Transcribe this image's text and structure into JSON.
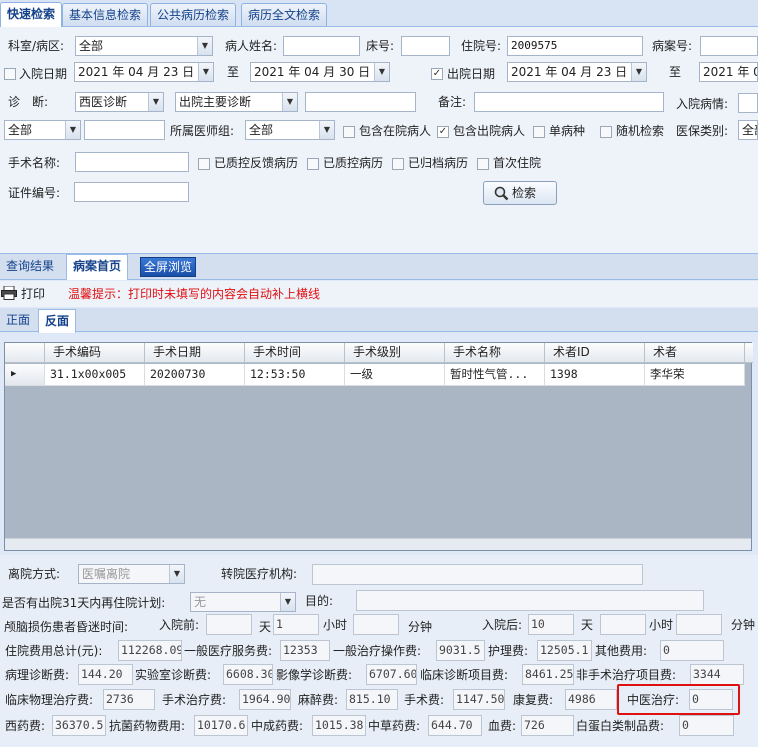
{
  "top_tabs": [
    "快速检索",
    "基本信息检索",
    "公共病历检索",
    "病历全文检索"
  ],
  "search": {
    "dept_label": "科室/病区:",
    "dept_value": "全部",
    "patient_name_label": "病人姓名:",
    "patient_name_value": "",
    "bed_label": "床号:",
    "bed_value": "",
    "inpatient_no_label": "住院号:",
    "inpatient_no_value": "2009575",
    "case_no_label": "病案号:",
    "case_no_value": "",
    "admit_date_label": "入院日期",
    "admit_from": "2021 年 04 月 23 日",
    "to_label": "至",
    "admit_to": "2021 年 04 月 30 日",
    "discharge_date_label": "出院日期",
    "discharge_from": "2021 年 04 月 23 日",
    "discharge_to_label": "至",
    "discharge_to": "2021 年 0",
    "diag_label": "诊　断:",
    "diag_type": "西医诊断",
    "diag_kind": "出院主要诊断",
    "diag_value": "",
    "remark_label": "备注:",
    "remark_value": "",
    "admit_condition_label": "入院病情:",
    "admit_condition_value": "",
    "scope_value": "全部",
    "scope_text": "",
    "doctor_group_label": "所属医师组:",
    "doctor_group_value": "全部",
    "cb_include_inpatient": "包含在院病人",
    "cb_include_discharged": "包含出院病人",
    "cb_single": "单病种",
    "cb_random": "随机检索",
    "insurance_label": "医保类别:",
    "insurance_value": "全部",
    "surgery_label": "手术名称:",
    "surgery_value": "",
    "cb_qc_feedback": "已质控反馈病历",
    "cb_qc": "已质控病历",
    "cb_archived": "已归档病历",
    "cb_first": "首次住院",
    "cert_label": "证件编号:",
    "cert_value": "",
    "search_button": "检索"
  },
  "result_tabs": [
    "查询结果",
    "病案首页",
    "全屏浏览"
  ],
  "toolbar": {
    "print": "打印",
    "hint": "温馨提示：打印时未填写的内容会自动补上横线"
  },
  "page_tabs": [
    "正面",
    "反面"
  ],
  "table": {
    "columns": [
      "手术编码",
      "手术日期",
      "手术时间",
      "手术级别",
      "手术名称",
      "术者ID",
      "术者"
    ],
    "rows": [
      [
        "31.1x00x005",
        "20200730",
        "12:53:50",
        "一级",
        "暂时性气管...",
        "1398",
        "李华荣"
      ]
    ]
  },
  "discharge": {
    "mode_label": "离院方式:",
    "mode_value": "医嘱离院",
    "transfer_label": "转院医疗机构:",
    "transfer_value": "",
    "readmit_label": "是否有出院31天内再住院计划:",
    "readmit_value": "无",
    "purpose_label": "目的:",
    "purpose_value": "",
    "coma_label": "颅脑损伤患者昏迷时间:",
    "before_label": "入院前:",
    "before_day": "",
    "day_label": "天",
    "before_hour": "1",
    "hour_label": "小时",
    "before_min": "",
    "min_label": "分钟",
    "after_label": "入院后:",
    "after_day": "10",
    "day_label2": "天",
    "after_hour": "",
    "hour_label2": "小时",
    "after_min": "",
    "min_label2": "分钟"
  },
  "fees": {
    "total_label": "住院费用总计(元):",
    "total": "112268.09",
    "general_service_label": "一般医疗服务费:",
    "general_service": "12353",
    "general_treatment_label": "一般治疗操作费:",
    "general_treatment": "9031.5",
    "nursing_label": "护理费:",
    "nursing": "12505.1",
    "other_label": "其他费用:",
    "other": "0",
    "pathology_label": "病理诊断费:",
    "pathology": "144.20",
    "lab_label": "实验室诊断费:",
    "lab": "6608.30",
    "imaging_label": "影像学诊断费:",
    "imaging": "6707.60",
    "clinical_diag_label": "临床诊断项目费:",
    "clinical_diag": "8461.25",
    "non_surgical_label": "非手术治疗项目费:",
    "non_surgical": "3344",
    "physio_label": "临床物理治疗费:",
    "physio": "2736",
    "surgical_treat_label": "手术治疗费:",
    "surgical_treat": "1964.90",
    "anesthesia_label": "麻醉费:",
    "anesthesia": "815.10",
    "surgery_fee_label": "手术费:",
    "surgery_fee": "1147.50",
    "rehab_label": "康复费:",
    "rehab": "4986",
    "tcm_label": "中医治疗:",
    "tcm": "0",
    "western_label": "西药费:",
    "western": "36370.5",
    "antibiotic_label": "抗菌药物费用:",
    "antibiotic": "10170.6",
    "chinese_patent_label": "中成药费:",
    "chinese_patent": "1015.38",
    "herbal_label": "中草药费:",
    "herbal": "644.70",
    "blood_label": "血费:",
    "blood": "726",
    "albumin_label": "白蛋白类制品费:",
    "albumin": "0"
  },
  "colors": {
    "tab_text": "#15428b",
    "hint_red": "#e01010",
    "highlight": "#e01010"
  }
}
